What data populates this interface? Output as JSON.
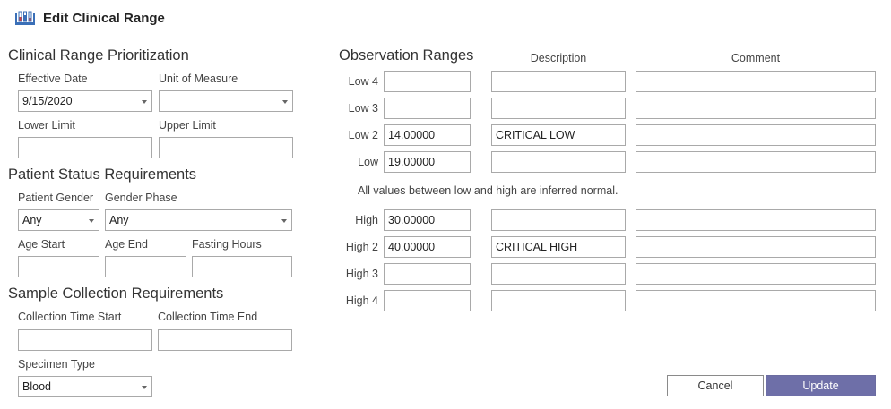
{
  "window": {
    "title": "Edit Clinical Range",
    "icon": "test-tubes-icon"
  },
  "prioritization": {
    "heading": "Clinical Range Prioritization",
    "effective_date_label": "Effective Date",
    "effective_date_value": "9/15/2020",
    "unit_label": "Unit of Measure",
    "unit_value": "",
    "lower_limit_label": "Lower Limit",
    "lower_limit_value": "",
    "upper_limit_label": "Upper Limit",
    "upper_limit_value": ""
  },
  "patient_status": {
    "heading": "Patient Status Requirements",
    "gender_label": "Patient Gender",
    "gender_value": "Any",
    "phase_label": "Gender Phase",
    "phase_value": "Any",
    "age_start_label": "Age Start",
    "age_start_value": "",
    "age_end_label": "Age End",
    "age_end_value": "",
    "fasting_label": "Fasting Hours",
    "fasting_value": ""
  },
  "sample_collection": {
    "heading": "Sample Collection Requirements",
    "time_start_label": "Collection Time Start",
    "time_start_value": "",
    "time_end_label": "Collection Time End",
    "time_end_value": "",
    "specimen_label": "Specimen Type",
    "specimen_value": "Blood"
  },
  "observation": {
    "heading": "Observation Ranges",
    "description_header": "Description",
    "comment_header": "Comment",
    "note": "All values between low and high are inferred normal.",
    "rows": [
      {
        "label": "Low 4",
        "value": "",
        "description": "",
        "comment": ""
      },
      {
        "label": "Low 3",
        "value": "",
        "description": "",
        "comment": ""
      },
      {
        "label": "Low 2",
        "value": "14.00000",
        "description": "CRITICAL LOW",
        "comment": ""
      },
      {
        "label": "Low",
        "value": "19.00000",
        "description": "",
        "comment": ""
      },
      {
        "label": "High",
        "value": "30.00000",
        "description": "",
        "comment": ""
      },
      {
        "label": "High 2",
        "value": "40.00000",
        "description": "CRITICAL HIGH",
        "comment": ""
      },
      {
        "label": "High 3",
        "value": "",
        "description": "",
        "comment": ""
      },
      {
        "label": "High 4",
        "value": "",
        "description": "",
        "comment": ""
      }
    ]
  },
  "buttons": {
    "cancel_label": "Cancel",
    "update_label": "Update"
  },
  "colors": {
    "update_button": "#6e6fa8",
    "icon_blue": "#3a6fb7",
    "icon_red": "#d04040"
  }
}
